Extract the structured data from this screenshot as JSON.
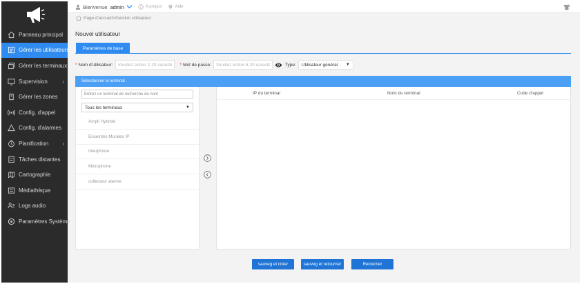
{
  "topbar": {
    "welcome": "Bienvenue",
    "user": "admin",
    "about": "A propos",
    "help": "Aide"
  },
  "breadcrumb": "Page d'accueil>Gestion utilisateur",
  "sidebar": {
    "items": [
      {
        "label": "Panneau principal",
        "icon": "home-icon"
      },
      {
        "label": "Gérer les utilisateurs",
        "icon": "user-list-icon",
        "active": true
      },
      {
        "label": "Gérer les terminaux",
        "icon": "terminal-icon"
      },
      {
        "label": "Supervision",
        "icon": "monitor-icon",
        "has_submenu": true
      },
      {
        "label": "Gérer les zones",
        "icon": "zones-icon"
      },
      {
        "label": "Config. d'appel",
        "icon": "broadcast-icon"
      },
      {
        "label": "Config. d'alarmes",
        "icon": "alarm-icon"
      },
      {
        "label": "Planification",
        "icon": "clock-icon",
        "has_submenu": true
      },
      {
        "label": "Tâches distantes",
        "icon": "task-icon"
      },
      {
        "label": "Cartographie",
        "icon": "map-icon"
      },
      {
        "label": "Médiathèque",
        "icon": "media-icon"
      },
      {
        "label": "Logs audio",
        "icon": "logs-icon"
      },
      {
        "label": "Paramètres Système",
        "icon": "settings-icon"
      }
    ]
  },
  "page": {
    "title": "Nouvel utilisateur",
    "tab": "Paramètres de base"
  },
  "form": {
    "username_label": "Nom d'utilisateur:",
    "username_placeholder": "Veuillez entrer 2-20 caracté",
    "password_label": "Mot de passe:",
    "password_placeholder": "Veuillez entrer 6-20 caracté",
    "type_label": "Type:",
    "type_value": "Utilisateur général"
  },
  "terminal": {
    "header": "Sélectionner le terminal",
    "search_placeholder": "Entrez un terminal de recherche de nom",
    "filter_value": "Tous les terminaux",
    "list": [
      "Ampli Hybride",
      "Enceintes Murales IP",
      "Interphone",
      "Microphone",
      "collecteur alarme"
    ],
    "columns": {
      "ip": "IP du terminal",
      "name": "Nom du terminal",
      "code": "Code d'appel"
    }
  },
  "buttons": {
    "save_create": "sauveg et créer",
    "save_return": "sauveg et retourner",
    "return": "Retourner"
  },
  "colors": {
    "sidebar_bg": "#2b2b2b",
    "accent": "#2f8bef",
    "button": "#1f74d6"
  }
}
